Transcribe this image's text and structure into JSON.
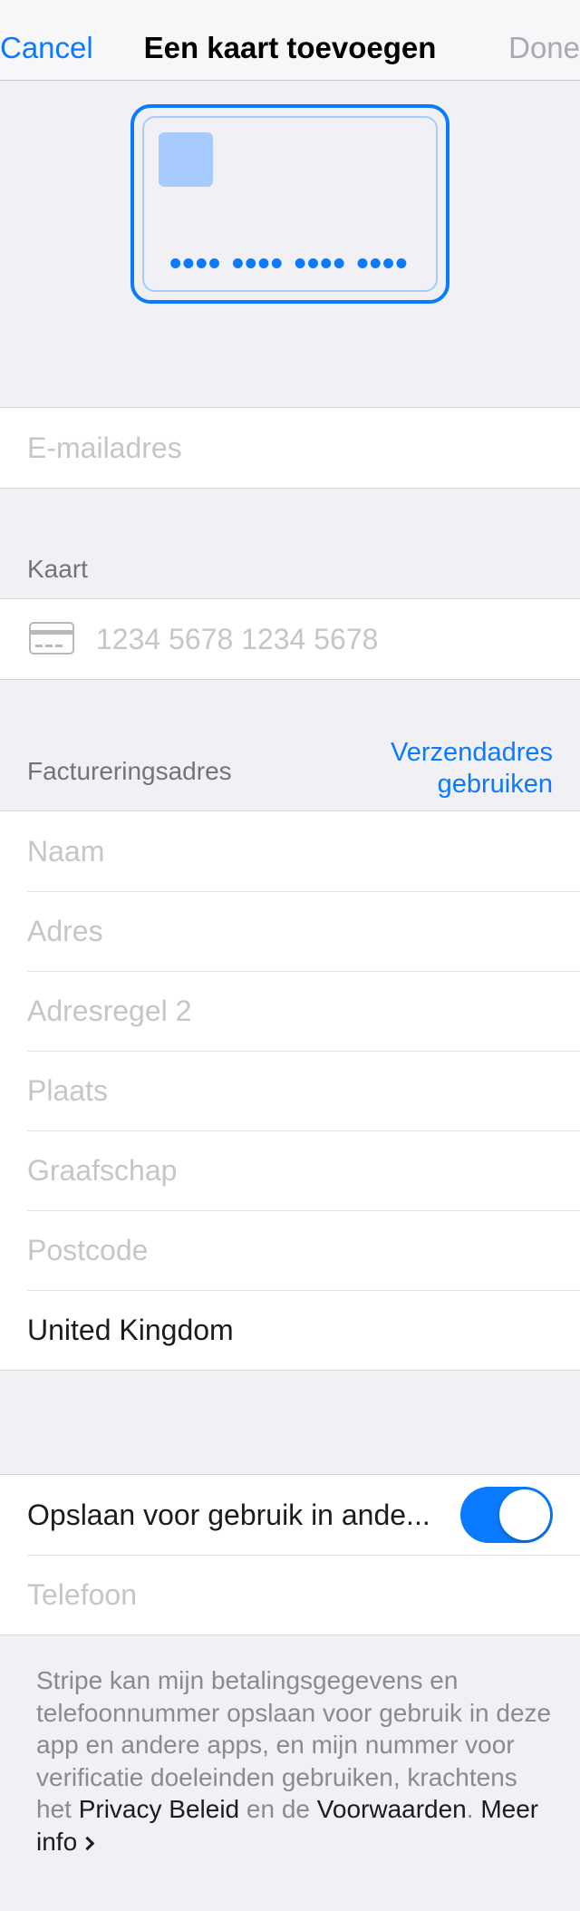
{
  "nav": {
    "cancel": "Cancel",
    "title": "Een kaart toevoegen",
    "done": "Done"
  },
  "card_preview": {
    "number_mask": "•••• •••• •••• ••••"
  },
  "email": {
    "placeholder": "E-mailadres"
  },
  "card_section": {
    "label": "Kaart",
    "number_placeholder": "1234 5678 1234 5678",
    "icon": "credit-card-icon"
  },
  "billing": {
    "label": "Factureringsadres",
    "use_shipping_line1": "Verzendadres",
    "use_shipping_line2": "gebruiken",
    "fields": [
      {
        "placeholder": "Naam"
      },
      {
        "placeholder": "Adres"
      },
      {
        "placeholder": "Adresregel 2"
      },
      {
        "placeholder": "Plaats"
      },
      {
        "placeholder": "Graafschap"
      },
      {
        "placeholder": "Postcode"
      }
    ],
    "country": "United Kingdom"
  },
  "save": {
    "label": "Opslaan voor gebruik in ande...",
    "toggle_on": true,
    "phone_placeholder": "Telefoon"
  },
  "footer": {
    "text1": "Stripe kan mijn betalingsgegevens en telefoonnummer opslaan voor gebruik in deze app en andere apps, en mijn nummer voor verificatie doeleinden gebruiken, krachtens het ",
    "privacy": "Privacy Beleid",
    "text2": " en de ",
    "terms": "Voorwaarden",
    "text3": ". ",
    "more": "Meer info"
  },
  "colors": {
    "accent": "#0a7aff",
    "background": "#f0f0f5",
    "placeholder": "#c5c5ca"
  }
}
